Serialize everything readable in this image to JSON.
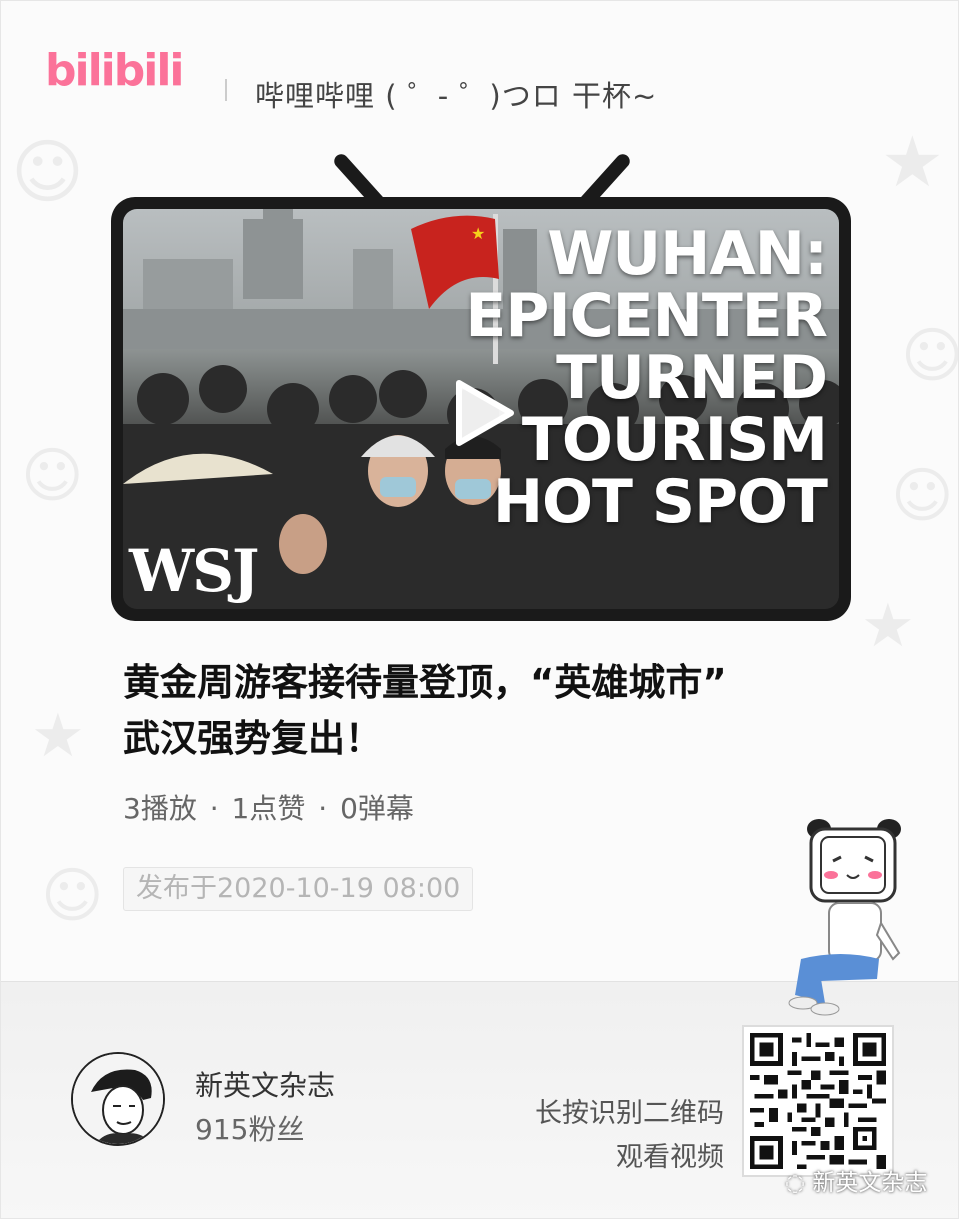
{
  "header": {
    "logo_text": "bilibili",
    "slogan": "哔哩哔哩 ( ゜- ゜)つロ 干杯~"
  },
  "video": {
    "thumbnail_headline": [
      "WUHAN:",
      "EPICENTER",
      "TURNED",
      "TOURISM",
      "HOT SPOT"
    ],
    "thumbnail_source_mark": "WSJ",
    "title_line1": "黄金周游客接待量登顶，“英雄城市”",
    "title_line2": "武汉强势复出！",
    "plays": "3播放",
    "likes": "1点赞",
    "danmaku": "0弹幕",
    "separator": "·",
    "publish_time": "发布于2020-10-19 08:00"
  },
  "uploader": {
    "name": "新英文杂志",
    "followers": "915粉丝"
  },
  "qr": {
    "hint_line1": "长按识别二维码",
    "hint_line2": "观看视频",
    "watermark": "新英文杂志"
  },
  "colors": {
    "brand_pink": "#fb7299",
    "tv_frame": "#1a1a1a",
    "mascot_blue": "#5a8fd6"
  }
}
